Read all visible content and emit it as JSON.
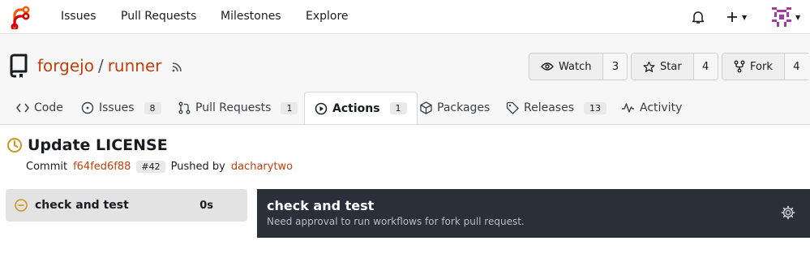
{
  "nav": {
    "items": [
      "Issues",
      "Pull Requests",
      "Milestones",
      "Explore"
    ],
    "logo_icon": "forgejo-logo-icon",
    "notification_icon": "bell-icon",
    "create_icon": "plus-icon",
    "avatar_icon": "user-avatar"
  },
  "repo": {
    "owner": "forgejo",
    "separator": "/",
    "name": "runner",
    "watch_label": "Watch",
    "watch_count": "3",
    "star_label": "Star",
    "star_count": "4",
    "fork_label": "Fork",
    "fork_count": "4"
  },
  "tabs": [
    {
      "label": "Code",
      "icon": "code-icon",
      "count": ""
    },
    {
      "label": "Issues",
      "icon": "issue-icon",
      "count": "8"
    },
    {
      "label": "Pull Requests",
      "icon": "pull-request-icon",
      "count": "1"
    },
    {
      "label": "Actions",
      "icon": "play-icon",
      "count": "1"
    },
    {
      "label": "Packages",
      "icon": "package-icon",
      "count": ""
    },
    {
      "label": "Releases",
      "icon": "tag-icon",
      "count": "13"
    },
    {
      "label": "Activity",
      "icon": "pulse-icon",
      "count": ""
    }
  ],
  "active_tab": "Actions",
  "run": {
    "title": "Update LICENSE",
    "status_icon": "clock-icon",
    "commit_label": "Commit",
    "commit_sha": "f64fed6f88",
    "pr_ref": "#42",
    "pushed_by_label": "Pushed by",
    "author": "dacharytwo"
  },
  "jobs": [
    {
      "name": "check and test",
      "duration": "0s",
      "status_icon": "blocked-icon"
    }
  ],
  "job_panel": {
    "title": "check and test",
    "message": "Need approval to run workflows for fork pull request.",
    "settings_icon": "gear-icon"
  },
  "colors": {
    "accent": "#c2410c",
    "panel_bg": "#2a2f3a",
    "status_waiting": "#c99a1a"
  }
}
